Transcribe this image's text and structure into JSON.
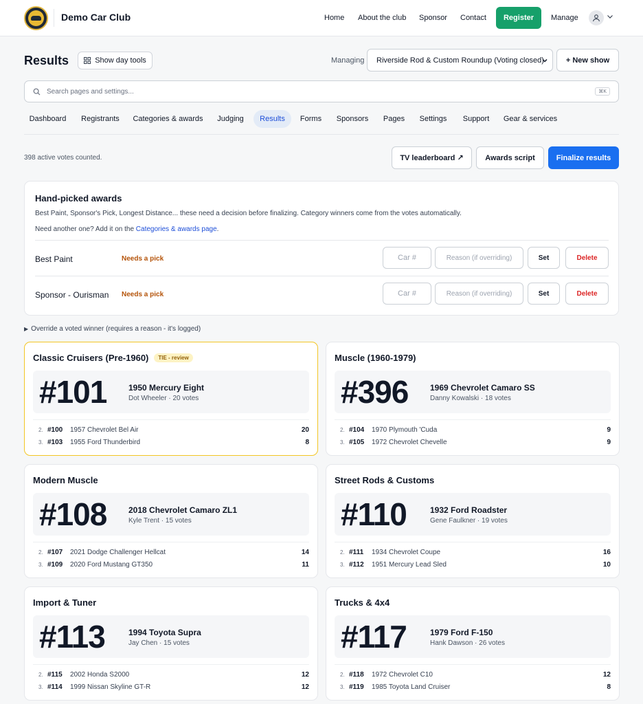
{
  "brand": {
    "name": "Demo Car Club"
  },
  "nav": {
    "home": "Home",
    "about": "About the club",
    "sponsor": "Sponsor",
    "contact": "Contact",
    "register": "Register",
    "manage": "Manage"
  },
  "header": {
    "title": "Results",
    "day_tools": "Show day tools",
    "managing_label": "Managing",
    "show_select": "Riverside Rod & Custom Roundup (Voting closed)",
    "new_show": "+ New show"
  },
  "search": {
    "placeholder": "Search pages and settings...",
    "shortcut": "⌘K"
  },
  "tabs": [
    "Dashboard",
    "Registrants",
    "Categories & awards",
    "Judging",
    "Results",
    "Forms",
    "Sponsors",
    "Pages",
    "Settings",
    "Support",
    "Gear & services"
  ],
  "active_tab": "Results",
  "summary": {
    "votes": "398 active votes counted.",
    "tv": "TV leaderboard ↗",
    "script": "Awards script",
    "finalize": "Finalize results"
  },
  "hand_picked": {
    "title": "Hand-picked awards",
    "desc": "Best Paint, Sponsor's Pick, Longest Distance... these need a decision before finalizing. Category winners come from the votes automatically.",
    "more_prefix": "Need another one? Add it on the ",
    "more_link": "Categories & awards page",
    "more_suffix": ".",
    "rows": [
      {
        "name": "Best Paint",
        "status": "Needs a pick",
        "car_ph": "Car #",
        "reason_ph": "Reason (if overriding)",
        "set": "Set",
        "delete": "Delete"
      },
      {
        "name": "Sponsor - Ourisman",
        "status": "Needs a pick",
        "car_ph": "Car #",
        "reason_ph": "Reason (if overriding)",
        "set": "Set",
        "delete": "Delete"
      }
    ]
  },
  "override": "Override a voted winner (requires a reason - it's logged)",
  "categories": [
    {
      "title": "Classic Cruisers (Pre-1960)",
      "badge": "TIE - review",
      "num": "#101",
      "car": "1950 Mercury Eight",
      "meta": "Dot Wheeler · 20 votes",
      "runners": [
        {
          "rank": "2.",
          "num": "#100",
          "car": "1957 Chevrolet Bel Air",
          "votes": "20"
        },
        {
          "rank": "3.",
          "num": "#103",
          "car": "1955 Ford Thunderbird",
          "votes": "8"
        }
      ]
    },
    {
      "title": "Muscle (1960-1979)",
      "badge": "",
      "num": "#396",
      "car": "1969 Chevrolet Camaro SS",
      "meta": "Danny Kowalski · 18 votes",
      "runners": [
        {
          "rank": "2.",
          "num": "#104",
          "car": "1970 Plymouth 'Cuda",
          "votes": "9"
        },
        {
          "rank": "3.",
          "num": "#105",
          "car": "1972 Chevrolet Chevelle",
          "votes": "9"
        }
      ]
    },
    {
      "title": "Modern Muscle",
      "badge": "",
      "num": "#108",
      "car": "2018 Chevrolet Camaro ZL1",
      "meta": "Kyle Trent · 15 votes",
      "runners": [
        {
          "rank": "2.",
          "num": "#107",
          "car": "2021 Dodge Challenger Hellcat",
          "votes": "14"
        },
        {
          "rank": "3.",
          "num": "#109",
          "car": "2020 Ford Mustang GT350",
          "votes": "11"
        }
      ]
    },
    {
      "title": "Street Rods & Customs",
      "badge": "",
      "num": "#110",
      "car": "1932 Ford Roadster",
      "meta": "Gene Faulkner · 19 votes",
      "runners": [
        {
          "rank": "2.",
          "num": "#111",
          "car": "1934 Chevrolet Coupe",
          "votes": "16"
        },
        {
          "rank": "3.",
          "num": "#112",
          "car": "1951 Mercury Lead Sled",
          "votes": "10"
        }
      ]
    },
    {
      "title": "Import & Tuner",
      "badge": "",
      "num": "#113",
      "car": "1994 Toyota Supra",
      "meta": "Jay Chen · 15 votes",
      "runners": [
        {
          "rank": "2.",
          "num": "#115",
          "car": "2002 Honda S2000",
          "votes": "12"
        },
        {
          "rank": "3.",
          "num": "#114",
          "car": "1999 Nissan Skyline GT-R",
          "votes": "12"
        }
      ]
    },
    {
      "title": "Trucks & 4x4",
      "badge": "",
      "num": "#117",
      "car": "1979 Ford F-150",
      "meta": "Hank Dawson · 26 votes",
      "runners": [
        {
          "rank": "2.",
          "num": "#118",
          "car": "1972 Chevrolet C10",
          "votes": "12"
        },
        {
          "rank": "3.",
          "num": "#119",
          "car": "1985 Toyota Land Cruiser",
          "votes": "8"
        }
      ]
    }
  ],
  "colors": {
    "accent": "#1a6ff0",
    "register": "#16a06a",
    "needs_pick": "#b45309",
    "delete": "#dc2626",
    "tie_border": "#f3c623"
  }
}
